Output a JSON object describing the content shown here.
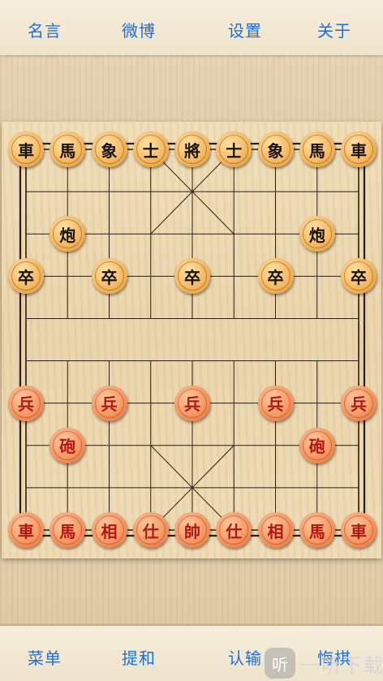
{
  "top_nav": {
    "quotes": "名言",
    "weibo": "微博",
    "settings": "设置",
    "about": "关于"
  },
  "bottom_nav": {
    "menu": "菜单",
    "draw": "提和",
    "resign": "认输",
    "undo": "悔棋"
  },
  "watermark": {
    "icon_glyph": "听",
    "text": "一听下载"
  },
  "board": {
    "columns": 9,
    "rows": 10,
    "pieces": [
      {
        "side": "black",
        "char": "車",
        "col": 0,
        "row": 0
      },
      {
        "side": "black",
        "char": "馬",
        "col": 1,
        "row": 0
      },
      {
        "side": "black",
        "char": "象",
        "col": 2,
        "row": 0
      },
      {
        "side": "black",
        "char": "士",
        "col": 3,
        "row": 0
      },
      {
        "side": "black",
        "char": "將",
        "col": 4,
        "row": 0
      },
      {
        "side": "black",
        "char": "士",
        "col": 5,
        "row": 0
      },
      {
        "side": "black",
        "char": "象",
        "col": 6,
        "row": 0
      },
      {
        "side": "black",
        "char": "馬",
        "col": 7,
        "row": 0
      },
      {
        "side": "black",
        "char": "車",
        "col": 8,
        "row": 0
      },
      {
        "side": "black",
        "char": "炮",
        "col": 1,
        "row": 2
      },
      {
        "side": "black",
        "char": "炮",
        "col": 7,
        "row": 2
      },
      {
        "side": "black",
        "char": "卒",
        "col": 0,
        "row": 3
      },
      {
        "side": "black",
        "char": "卒",
        "col": 2,
        "row": 3
      },
      {
        "side": "black",
        "char": "卒",
        "col": 4,
        "row": 3
      },
      {
        "side": "black",
        "char": "卒",
        "col": 6,
        "row": 3
      },
      {
        "side": "black",
        "char": "卒",
        "col": 8,
        "row": 3
      },
      {
        "side": "red",
        "char": "兵",
        "col": 0,
        "row": 6
      },
      {
        "side": "red",
        "char": "兵",
        "col": 2,
        "row": 6
      },
      {
        "side": "red",
        "char": "兵",
        "col": 4,
        "row": 6
      },
      {
        "side": "red",
        "char": "兵",
        "col": 6,
        "row": 6
      },
      {
        "side": "red",
        "char": "兵",
        "col": 8,
        "row": 6
      },
      {
        "side": "red",
        "char": "砲",
        "col": 1,
        "row": 7
      },
      {
        "side": "red",
        "char": "砲",
        "col": 7,
        "row": 7
      },
      {
        "side": "red",
        "char": "車",
        "col": 0,
        "row": 9
      },
      {
        "side": "red",
        "char": "馬",
        "col": 1,
        "row": 9
      },
      {
        "side": "red",
        "char": "相",
        "col": 2,
        "row": 9
      },
      {
        "side": "red",
        "char": "仕",
        "col": 3,
        "row": 9
      },
      {
        "side": "red",
        "char": "帥",
        "col": 4,
        "row": 9
      },
      {
        "side": "red",
        "char": "仕",
        "col": 5,
        "row": 9
      },
      {
        "side": "red",
        "char": "相",
        "col": 6,
        "row": 9
      },
      {
        "side": "red",
        "char": "馬",
        "col": 7,
        "row": 9
      },
      {
        "side": "red",
        "char": "車",
        "col": 8,
        "row": 9
      }
    ]
  },
  "colors": {
    "nav_text": "#1c6fd6",
    "black_piece_text": "#1a1208",
    "red_piece_text": "#b4150f",
    "board_line": "#2a1e10"
  }
}
